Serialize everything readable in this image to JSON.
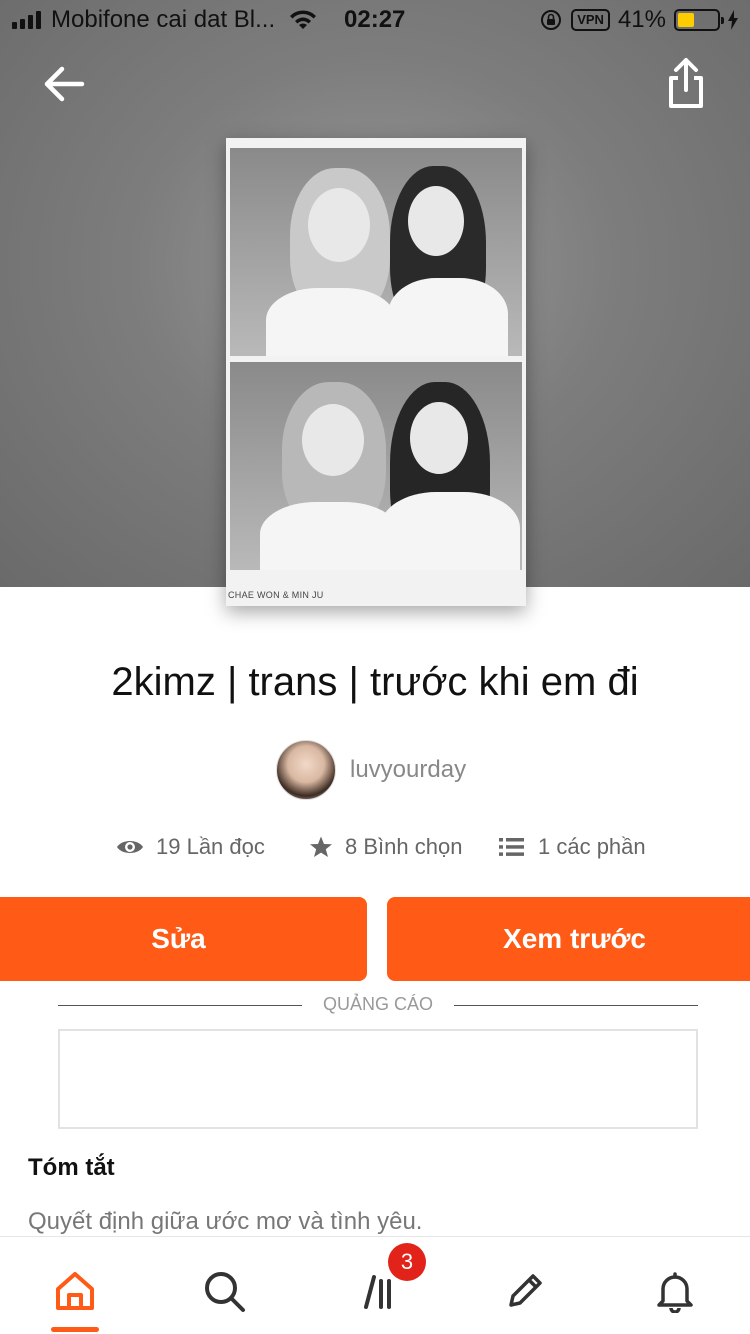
{
  "status_bar": {
    "carrier": "Mobifone cai dat Bl...",
    "time": "02:27",
    "vpn": "VPN",
    "battery": "41%",
    "battery_level": 0.41
  },
  "header": {
    "back_icon": "arrow-left-icon",
    "share_icon": "share-icon"
  },
  "cover": {
    "caption": "CHAE WON & MIN JU"
  },
  "story": {
    "title": "2kimz | trans | trước khi em đi",
    "author": "luvyourday"
  },
  "stats": {
    "reads": "19 Lần đọc",
    "votes": "8 Bình chọn",
    "parts": "1 các phần"
  },
  "actions": {
    "edit_label": "Sửa",
    "preview_label": "Xem trước"
  },
  "ad": {
    "label": "QUẢNG CÁO"
  },
  "summary": {
    "heading": "Tóm tắt",
    "text": "Quyết định giữa ước mơ và tình yêu."
  },
  "tabbar": {
    "items": [
      {
        "name": "home",
        "icon": "home-icon"
      },
      {
        "name": "search",
        "icon": "search-icon"
      },
      {
        "name": "library",
        "icon": "library-icon"
      },
      {
        "name": "write",
        "icon": "pencil-icon"
      },
      {
        "name": "notifications",
        "icon": "bell-icon"
      }
    ],
    "library_badge": "3",
    "accent": "#ff5a16"
  },
  "colors": {
    "accent": "#ff5a16",
    "badge": "#e2231a"
  }
}
